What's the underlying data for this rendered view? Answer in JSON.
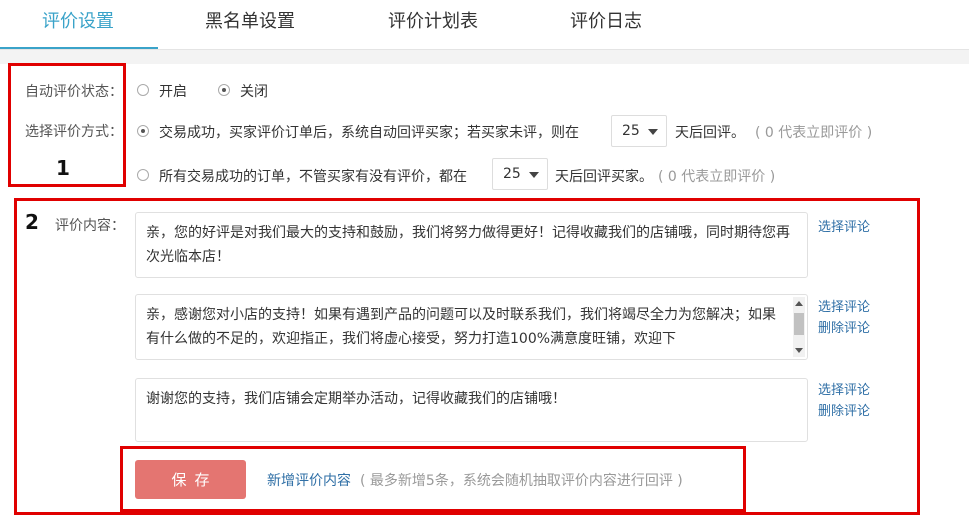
{
  "tabs": [
    {
      "label": "评价设置",
      "active": true
    },
    {
      "label": "黑名单设置",
      "active": false
    },
    {
      "label": "评价计划表",
      "active": false
    },
    {
      "label": "评价日志",
      "active": false
    }
  ],
  "auto_status": {
    "label": "自动评价状态：",
    "options": [
      "开启",
      "关闭"
    ],
    "selected": "关闭"
  },
  "method": {
    "label": "选择评价方式：",
    "option1": {
      "text_before": "交易成功，买家评价订单后，系统自动回评买家；若买家未评，则在",
      "days": "25",
      "text_after": "天后回评。",
      "hint": "( 0 代表立即评价 )",
      "checked": true
    },
    "option2": {
      "text_before": "所有交易成功的订单，不管买家有没有评价，都在",
      "days": "25",
      "text_after": "天后回评买家。",
      "hint": "( 0 代表立即评价 )",
      "checked": false
    }
  },
  "content": {
    "label": "评价内容：",
    "items": [
      {
        "text": "亲，您的好评是对我们最大的支持和鼓励，我们将努力做得更好！记得收藏我们的店铺哦，同时期待您再次光临本店！",
        "select_label": "选择评论",
        "delete_label": ""
      },
      {
        "text": "亲，感谢您对小店的支持！如果有遇到产品的问题可以及时联系我们，我们将竭尽全力为您解决；如果有什么做的不足的，欢迎指正，我们将虚心接受，努力打造100%满意度旺铺，欢迎下",
        "select_label": "选择评论",
        "delete_label": "删除评论"
      },
      {
        "text": "谢谢您的支持，我们店铺会定期举办活动，记得收藏我们的店铺哦！",
        "select_label": "选择评论",
        "delete_label": "删除评论"
      }
    ]
  },
  "actions": {
    "save_label": "保存",
    "add_label": "新增评价内容",
    "add_hint": "( 最多新增5条，系统会随机抽取评价内容进行回评 )"
  },
  "annotations": {
    "marker1": "1",
    "marker2": "2"
  },
  "colors": {
    "accent": "#3aa3c9",
    "save": "#e47571",
    "link": "#2f6fa6",
    "annotation": "#e00000"
  }
}
